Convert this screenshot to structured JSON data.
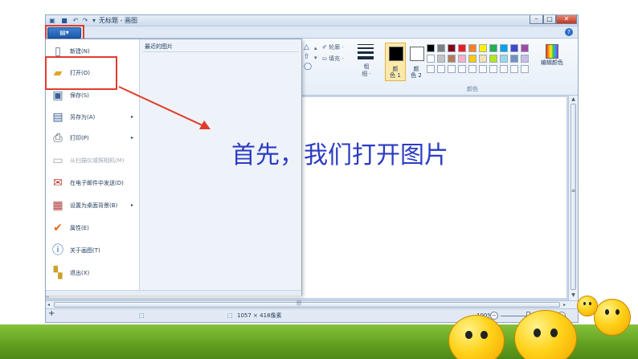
{
  "window": {
    "title": "无标题 - 画图",
    "quick_access": [
      "save-icon",
      "undo-icon",
      "redo-icon",
      "dropdown-icon"
    ],
    "controls": [
      "minimize",
      "maximize",
      "close"
    ]
  },
  "file_menu": {
    "button_label": "▤▾",
    "recent_title": "最近的图片",
    "items": [
      {
        "label": "新建(N)",
        "icon": "new-document-icon",
        "submenu": false,
        "enabled": true
      },
      {
        "label": "打开(O)",
        "icon": "open-folder-icon",
        "submenu": false,
        "enabled": true
      },
      {
        "label": "保存(S)",
        "icon": "save-icon",
        "submenu": false,
        "enabled": true
      },
      {
        "label": "另存为(A)",
        "icon": "save-as-icon",
        "submenu": true,
        "enabled": true
      },
      {
        "label": "打印(P)",
        "icon": "printer-icon",
        "submenu": true,
        "enabled": true
      },
      {
        "label": "从扫描仪或照相机(M)",
        "icon": "scanner-icon",
        "submenu": false,
        "enabled": false
      },
      {
        "label": "在电子邮件中发送(D)",
        "icon": "email-icon",
        "submenu": false,
        "enabled": true
      },
      {
        "label": "设置为桌面背景(B)",
        "icon": "desktop-background-icon",
        "submenu": true,
        "enabled": true
      },
      {
        "label": "属性(E)",
        "icon": "properties-check-icon",
        "submenu": false,
        "enabled": true
      },
      {
        "label": "关于画图(T)",
        "icon": "info-icon",
        "submenu": false,
        "enabled": true
      },
      {
        "label": "退出(X)",
        "icon": "exit-icon",
        "submenu": false,
        "enabled": true
      }
    ]
  },
  "ribbon": {
    "outline_label": "轮廓 ·",
    "fill_label": "填充 ·",
    "size_label": "粗\n细 ·",
    "color1_label": "颜\n色 1",
    "color2_label": "颜\n色 2",
    "edit_colors_label": "编辑颜色",
    "colors_group_label": "颜色",
    "color1": "#000000",
    "color2": "#ffffff",
    "palette_row1": [
      "#000000",
      "#7f7f7f",
      "#880015",
      "#ed1c24",
      "#ff7f27",
      "#fff200",
      "#22b14c",
      "#00a2e8",
      "#3f48cc",
      "#a349a4"
    ],
    "palette_row2": [
      "#ffffff",
      "#c3c3c3",
      "#b97a57",
      "#ffaec9",
      "#ffc90e",
      "#efe4b0",
      "#b5e61d",
      "#99d9ea",
      "#7092be",
      "#c8bfe7"
    ]
  },
  "statusbar": {
    "add_icon": "+",
    "selection_icon": "⬚",
    "size_text": "1057 × 418像素",
    "zoom": "100%",
    "zoom_out": "−",
    "zoom_in": "+"
  },
  "scrollbars": {
    "up_arrow": "▲",
    "down_arrow": "▼",
    "left_arrow": "◂",
    "right_arrow": "▸",
    "grip": "|||",
    "side_marker": "≡"
  },
  "annotation": {
    "caption": "首先，我们打开图片",
    "highlight_color": "#e23b2e",
    "caption_color": "#2b3cc2"
  }
}
